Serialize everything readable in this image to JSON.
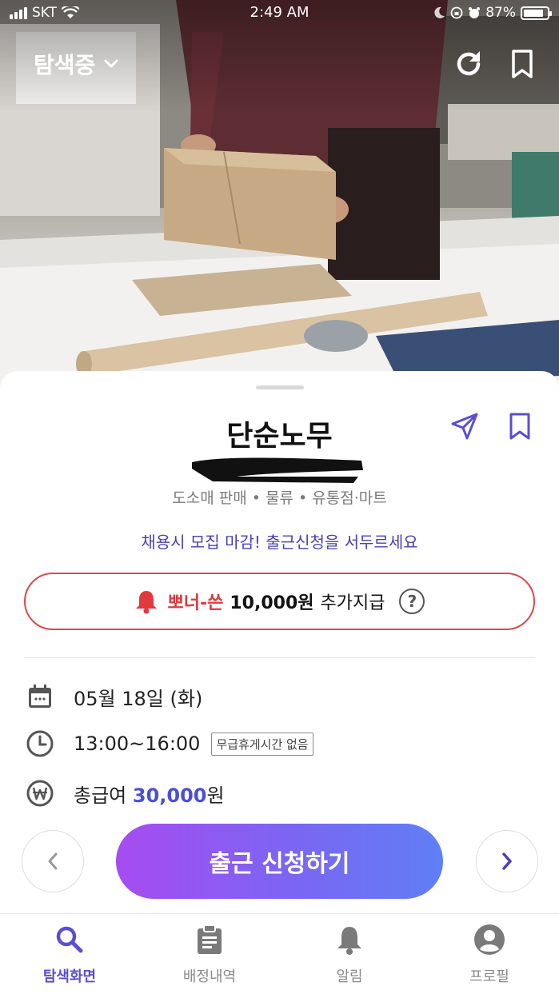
{
  "status_bar": {
    "carrier": "SKT",
    "time": "2:49 AM",
    "battery_percent": "87%",
    "battery_level": 0.87
  },
  "top_nav": {
    "filter_label": "탐색중"
  },
  "job": {
    "title": "단순노무",
    "category": "도소매 판매 • 물류 • 유통점·마트",
    "urgent_notice": "채용시 모집 마감! 출근신청을 서두르세요"
  },
  "bonus": {
    "name": "뽀너-쓴",
    "amount": "10,000원",
    "suffix": "추가지급",
    "help": "?"
  },
  "details": {
    "date": "05월 18일 (화)",
    "time": "13:00~16:00",
    "break_badge": "무급휴게시간 없음",
    "pay_label": "총급여",
    "pay_amount": "30,000",
    "pay_unit": "원"
  },
  "actions": {
    "apply_label": "출근 신청하기"
  },
  "tab_bar": {
    "tabs": [
      {
        "label": "탐색화면",
        "icon": "search-icon",
        "active": true
      },
      {
        "label": "배정내역",
        "icon": "clipboard-icon",
        "active": false
      },
      {
        "label": "알림",
        "icon": "bell-icon",
        "active": false
      },
      {
        "label": "프로필",
        "icon": "profile-icon",
        "active": false
      }
    ]
  },
  "colors": {
    "accent": "#5a4fd0",
    "bonus_red": "#e0393e",
    "apply_gradient_start": "#a64cf0",
    "apply_gradient_end": "#5f7ff5"
  }
}
